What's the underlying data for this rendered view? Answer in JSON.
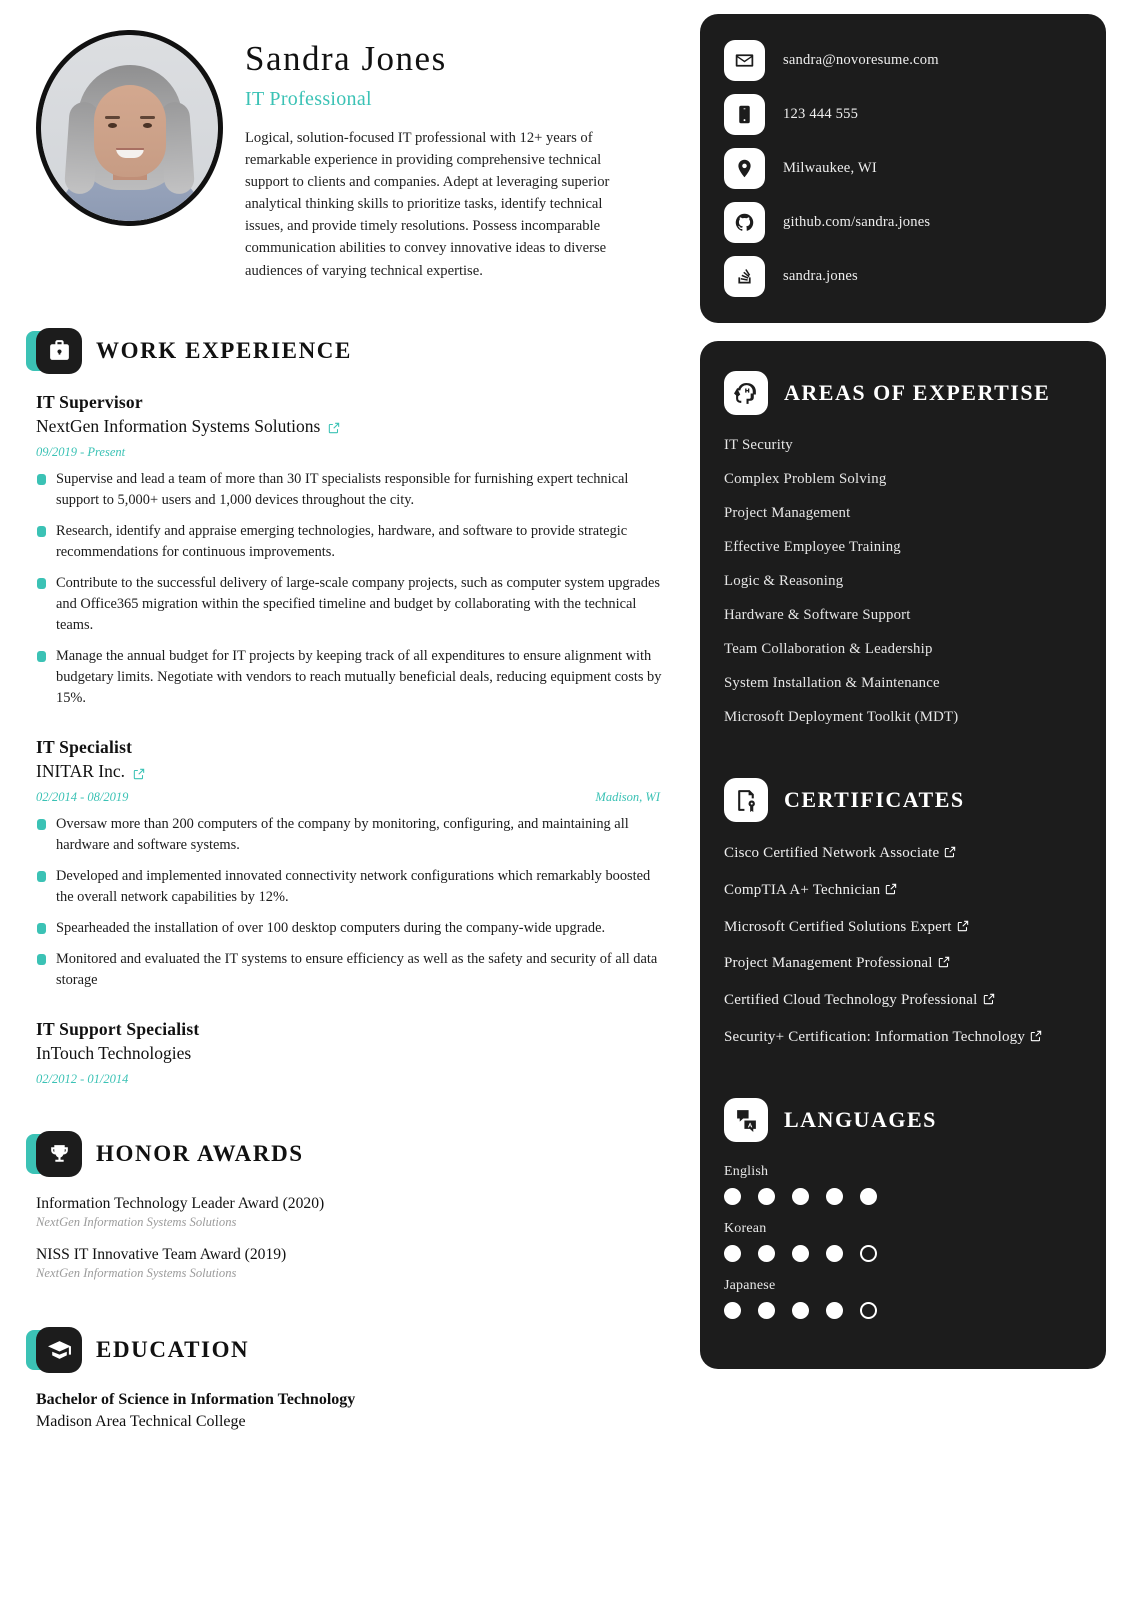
{
  "profile": {
    "name": "Sandra Jones",
    "title": "IT Professional",
    "summary": "Logical, solution-focused IT professional with 12+ years of remarkable experience in providing comprehensive technical support to clients and companies. Adept at leveraging superior analytical thinking skills to prioritize tasks, identify technical issues, and provide timely resolutions. Possess incomparable communication abilities to convey innovative ideas to diverse audiences of varying technical expertise.",
    "photo_alt": "portrait-photo"
  },
  "accent_color": "#3bc2b5",
  "dark_color": "#1c1c1c",
  "contact": [
    {
      "icon": "envelope-icon",
      "value": "sandra@novoresume.com"
    },
    {
      "icon": "phone-icon",
      "value": "123 444 555"
    },
    {
      "icon": "location-pin-icon",
      "value": "Milwaukee, WI"
    },
    {
      "icon": "github-icon",
      "value": "github.com/sandra.jones"
    },
    {
      "icon": "stackoverflow-icon",
      "value": "sandra.jones"
    }
  ],
  "work_experience": {
    "heading": "WORK EXPERIENCE",
    "icon": "briefcase-icon",
    "jobs": [
      {
        "role": "IT Supervisor",
        "company": "NextGen Information Systems Solutions",
        "has_link": true,
        "dates": "09/2019 - Present",
        "location": "",
        "bullets": [
          "Supervise and lead a team of more than 30 IT specialists responsible for furnishing expert technical support to 5,000+ users and 1,000 devices throughout the city.",
          "Research, identify and appraise emerging technologies, hardware, and software to provide strategic recommendations for continuous improvements.",
          "Contribute to the successful delivery of large-scale company projects, such as computer system upgrades and Office365 migration within the specified timeline and budget by collaborating with the technical teams.",
          "Manage the annual budget for IT projects by keeping track of all expenditures to ensure alignment with budgetary limits. Negotiate with vendors to reach mutually beneficial deals, reducing equipment costs by 15%."
        ]
      },
      {
        "role": "IT Specialist",
        "company": "INITAR Inc.",
        "has_link": true,
        "dates": "02/2014 - 08/2019",
        "location": "Madison, WI",
        "bullets": [
          "Oversaw more than 200 computers of the company by monitoring, configuring, and maintaining all hardware and software systems.",
          "Developed and implemented innovated connectivity network configurations which remarkably boosted the overall network capabilities by 12%.",
          "Spearheaded the installation of over 100 desktop computers during the company-wide upgrade.",
          "Monitored and evaluated the IT systems to ensure efficiency as well as the safety and security of all data storage"
        ]
      },
      {
        "role": "IT Support Specialist",
        "company": "InTouch Technologies",
        "has_link": false,
        "dates": "02/2012 - 01/2014",
        "location": "",
        "bullets": []
      }
    ]
  },
  "honor_awards": {
    "heading": "HONOR AWARDS",
    "icon": "trophy-icon",
    "items": [
      {
        "name": "Information Technology Leader Award (2020)",
        "org": "NextGen Information Systems Solutions"
      },
      {
        "name": "NISS IT Innovative Team Award (2019)",
        "org": "NextGen Information Systems Solutions"
      }
    ]
  },
  "education": {
    "heading": "EDUCATION",
    "icon": "graduation-cap-icon",
    "items": [
      {
        "degree": "Bachelor of Science in Information Technology",
        "school": "Madison Area Technical College"
      }
    ]
  },
  "areas_of_expertise": {
    "heading": "AREAS OF EXPERTISE",
    "icon": "brain-gear-icon",
    "items": [
      "IT Security",
      "Complex Problem Solving",
      "Project Management",
      "Effective Employee Training",
      "Logic & Reasoning",
      "Hardware & Software Support",
      "Team Collaboration & Leadership",
      "System Installation & Maintenance",
      "Microsoft Deployment Toolkit (MDT)"
    ]
  },
  "certificates": {
    "heading": "CERTIFICATES",
    "icon": "certificate-icon",
    "items": [
      {
        "name": "Cisco Certified Network Associate",
        "has_link": true
      },
      {
        "name": "CompTIA A+ Technician",
        "has_link": true
      },
      {
        "name": "Microsoft Certified Solutions Expert",
        "has_link": true
      },
      {
        "name": "Project Management Professional",
        "has_link": true
      },
      {
        "name": "Certified Cloud Technology Professional",
        "has_link": true
      },
      {
        "name": "Security+ Certification: Information Technology",
        "has_link": true
      }
    ]
  },
  "languages": {
    "heading": "LANGUAGES",
    "icon": "translate-icon",
    "max_level": 5,
    "items": [
      {
        "name": "English",
        "level": 5
      },
      {
        "name": "Korean",
        "level": 4
      },
      {
        "name": "Japanese",
        "level": 4
      }
    ]
  }
}
